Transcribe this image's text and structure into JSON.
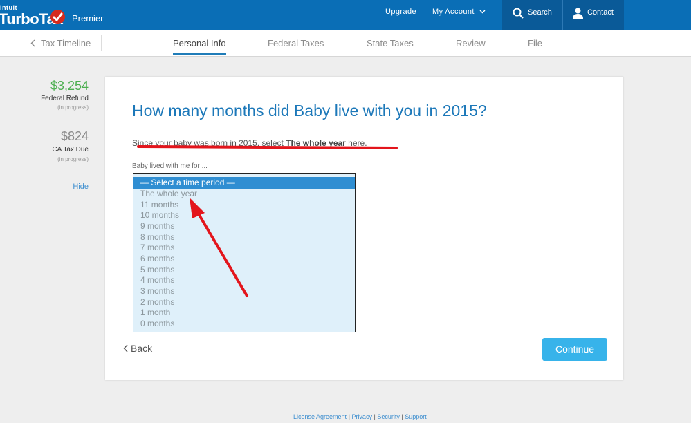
{
  "brand": {
    "intuit": "intuit",
    "name": "TurboTax",
    "edition": "Premier"
  },
  "topnav": {
    "upgrade": "Upgrade",
    "my_account": "My Account",
    "search": "Search",
    "contact": "Contact"
  },
  "subnav": {
    "timeline": "Tax Timeline",
    "tabs": [
      "Personal Info",
      "Federal Taxes",
      "State Taxes",
      "Review",
      "File"
    ],
    "active_tab": "Personal Info"
  },
  "sidebar": {
    "federal": {
      "amount": "$3,254",
      "label": "Federal Refund",
      "status": "(in progress)"
    },
    "state": {
      "amount": "$824",
      "label": "CA Tax Due",
      "status": "(in progress)"
    },
    "hide": "Hide"
  },
  "main": {
    "question": "How many months did Baby live with you in 2015?",
    "instruction_prefix": "Since your baby was born in 2015, select ",
    "instruction_bold": "The whole year",
    "instruction_suffix": " here.",
    "field_label": "Baby lived with me for ...",
    "options": [
      "— Select a time period —",
      "The whole year",
      "11 months",
      "10 months",
      "9 months",
      "8 months",
      "7 months",
      "6 months",
      "5 months",
      "4 months",
      "3 months",
      "2 months",
      "1 month",
      "0 months"
    ],
    "selected_option": "— Select a time period —",
    "back": "Back",
    "continue": "Continue"
  },
  "footer": {
    "links": [
      "License Agreement",
      "Privacy",
      "Security",
      "Support"
    ]
  },
  "colors": {
    "header": "#0a6eb6",
    "accent": "#1c78b9",
    "refund_green": "#4caf50",
    "continue_btn": "#37b3ea",
    "annotation_red": "#e3151c"
  },
  "icons": {
    "check": "check-icon",
    "search": "search-icon",
    "contact": "user-icon",
    "back": "chevron-left-icon",
    "dropdown": "chevron-down-icon"
  }
}
